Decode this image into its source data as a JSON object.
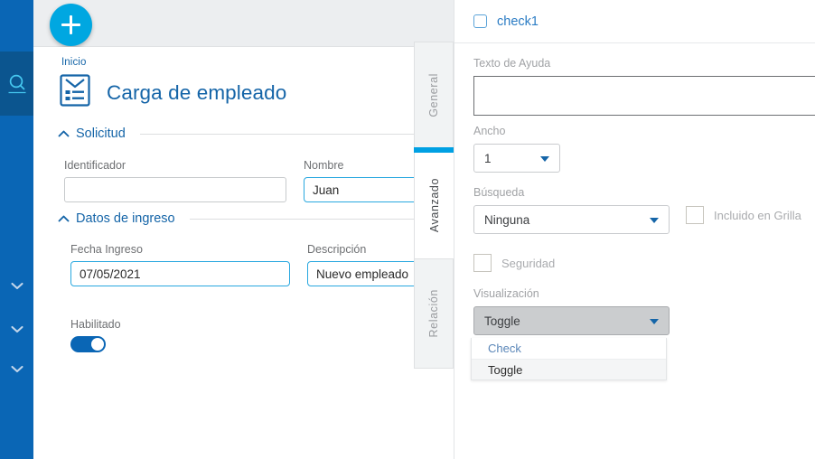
{
  "sidebar": {
    "search_icon": "search-icon",
    "chevrons": [
      {
        "icon": "chevron-down-icon"
      },
      {
        "icon": "chevron-down-icon"
      },
      {
        "icon": "chevron-down-icon"
      }
    ]
  },
  "topbar": {
    "fab_icon": "plus-icon",
    "fab_label": "+"
  },
  "main": {
    "breadcrumb": "Inicio",
    "title_icon": "form-document-icon",
    "title": "Carga de empleado",
    "sections": [
      {
        "label": "Solicitud",
        "caret_icon": "chevron-up-icon",
        "fields": [
          {
            "label": "Identificador",
            "value": "",
            "placeholder": ""
          },
          {
            "label": "Nombre",
            "value": "Juan",
            "placeholder": ""
          }
        ]
      },
      {
        "label": "Datos de ingreso",
        "caret_icon": "chevron-up-icon",
        "fields": [
          {
            "label": "Fecha Ingreso",
            "value": "07/05/2021",
            "placeholder": ""
          },
          {
            "label": "Descripción",
            "value": "Nuevo empleado",
            "placeholder": ""
          }
        ]
      }
    ],
    "toggle_field": {
      "label": "Habilitado",
      "state": "on"
    }
  },
  "tabstrip": {
    "tabs": [
      {
        "label": "General",
        "active": false
      },
      {
        "label": "Avanzado",
        "active": true
      },
      {
        "label": "Relación",
        "active": false
      }
    ],
    "indicator_color": "#00a0e3"
  },
  "panel": {
    "header": {
      "checkbox_label": "check1",
      "checked": false
    },
    "help_text": {
      "label": "Texto de Ayuda",
      "value": "",
      "placeholder": ""
    },
    "ancho": {
      "label": "Ancho",
      "value": "1",
      "caret_icon": "chevron-down-icon"
    },
    "busqueda": {
      "label": "Búsqueda",
      "value": "Ninguna",
      "caret_icon": "chevron-down-icon"
    },
    "incluido_en_grilla": {
      "label": "Incluido en Grilla",
      "checked": false
    },
    "seguridad": {
      "label": "Seguridad",
      "checked": false
    },
    "visualizacion": {
      "label": "Visualización",
      "value": "Toggle",
      "caret_icon": "chevron-down-icon",
      "options": [
        {
          "label": "Check",
          "selected": false
        },
        {
          "label": "Toggle",
          "selected": true
        }
      ]
    }
  },
  "colors": {
    "rail_blue": "#0a66b5",
    "rail_blue_dark": "#0b558f",
    "accent_cyan": "#00a7e1",
    "link_blue": "#1565a8",
    "tab_indicator": "#00a0e3"
  }
}
